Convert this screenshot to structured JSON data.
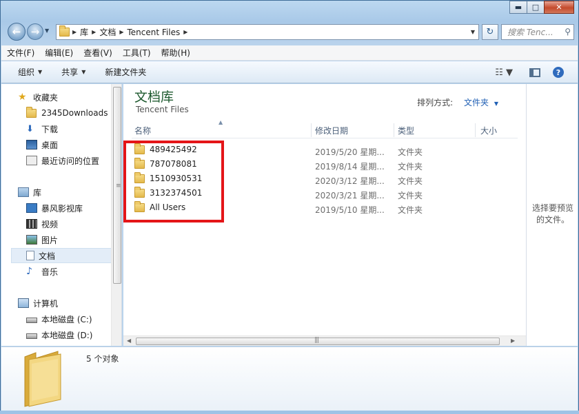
{
  "window": {
    "minimize_glyph": "▬",
    "maximize_glyph": "□",
    "close_glyph": "✕"
  },
  "address_bar": {
    "crumbs": [
      "库",
      "文档",
      "Tencent Files"
    ],
    "search_placeholder": "搜索 Tenc..."
  },
  "menu": {
    "items": [
      "文件(F)",
      "编辑(E)",
      "查看(V)",
      "工具(T)",
      "帮助(H)"
    ]
  },
  "toolbar": {
    "organize": "组织",
    "share": "共享",
    "new_folder": "新建文件夹"
  },
  "navigation": {
    "favorites_header": "收藏夹",
    "favorites": [
      "2345Downloads",
      "下载",
      "桌面",
      "最近访问的位置"
    ],
    "libraries_header": "库",
    "libraries": [
      "暴风影视库",
      "视频",
      "图片",
      "文档",
      "音乐"
    ],
    "selected": "文档",
    "computer_header": "计算机",
    "drives": [
      "本地磁盘 (C:)",
      "本地磁盘 (D:)"
    ]
  },
  "library": {
    "title": "文档库",
    "subtitle": "Tencent Files",
    "arrange_label": "排列方式:",
    "arrange_value": "文件夹"
  },
  "columns": {
    "name": "名称",
    "modified": "修改日期",
    "type": "类型",
    "size": "大小"
  },
  "files": [
    {
      "name": "489425492",
      "modified": "2019/5/20 星期...",
      "type": "文件夹"
    },
    {
      "name": "787078081",
      "modified": "2019/8/14 星期...",
      "type": "文件夹"
    },
    {
      "name": "1510930531",
      "modified": "2020/3/12 星期...",
      "type": "文件夹"
    },
    {
      "name": "3132374501",
      "modified": "2020/3/21 星期...",
      "type": "文件夹"
    },
    {
      "name": "All Users",
      "modified": "2019/5/10 星期...",
      "type": "文件夹"
    }
  ],
  "preview": {
    "message": "选择要预览的文件。"
  },
  "details": {
    "count": "5 个对象"
  },
  "colors": {
    "highlight_box": "#e41518",
    "library_title": "#1e5a2f",
    "link_blue": "#1f5fb4"
  }
}
